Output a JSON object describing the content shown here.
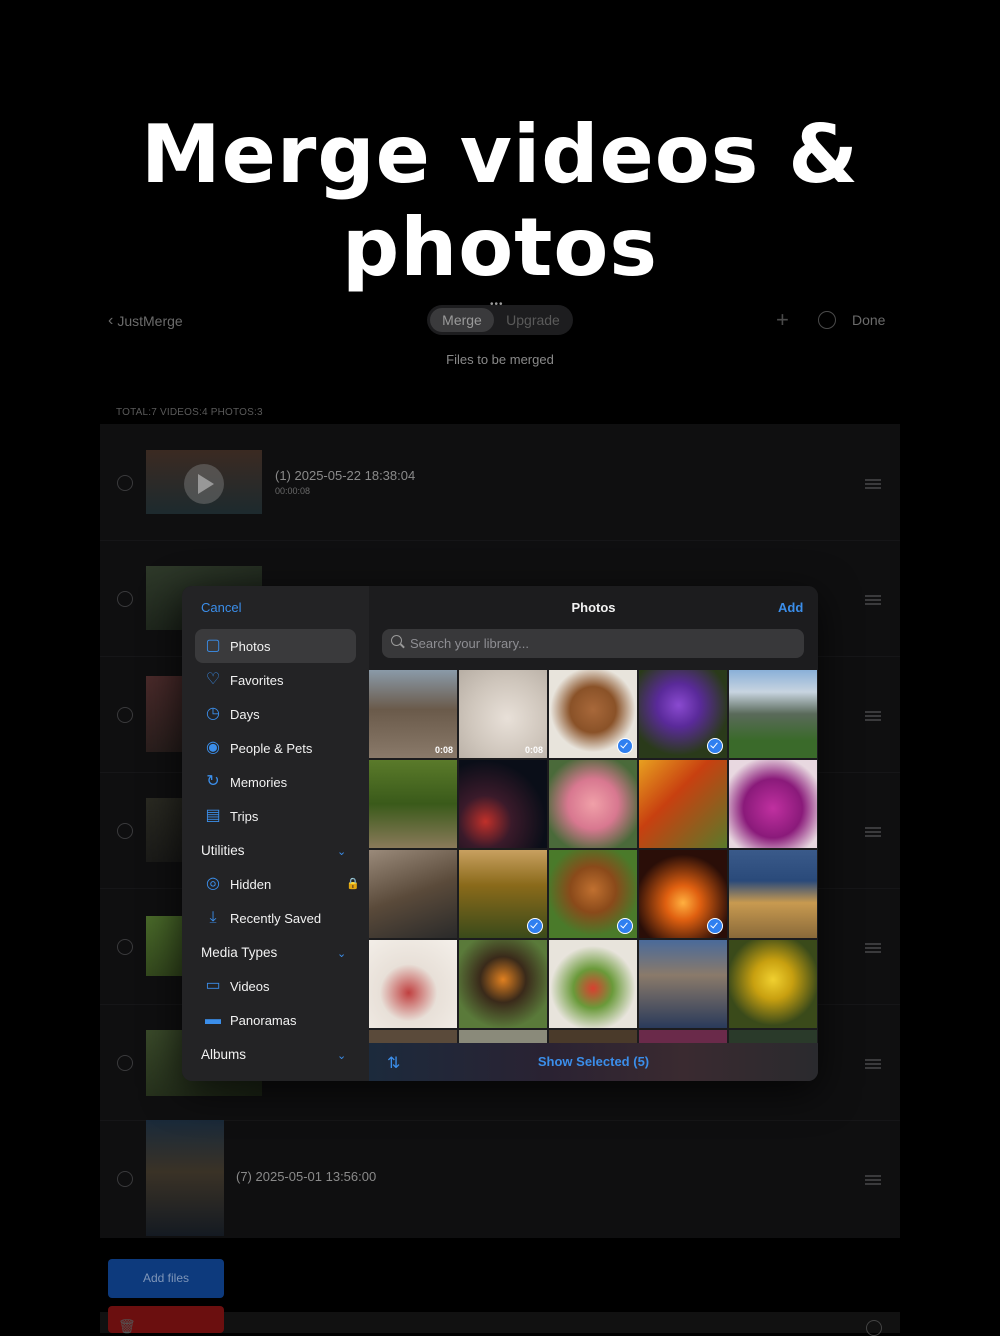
{
  "headline": "Merge videos & photos",
  "app": {
    "back_label": "JustMerge",
    "segments": [
      "Merge",
      "Upgrade"
    ],
    "done_label": "Done",
    "subtitle": "Files to be merged",
    "totals": "TOTAL:7 VIDEOS:4 PHOTOS:3",
    "rows": [
      {
        "title": "(1) 2025-05-22 18:38:04",
        "duration": "00:00:08"
      },
      {
        "title": "(7) 2025-05-01 13:56:00"
      }
    ],
    "add_files_label": "Add files"
  },
  "picker": {
    "cancel_label": "Cancel",
    "title": "Photos",
    "add_label": "Add",
    "search_placeholder": "Search your library...",
    "sidebar": {
      "items": [
        {
          "label": "Photos",
          "icon": "photos-icon",
          "selected": true
        },
        {
          "label": "Favorites",
          "icon": "heart-icon"
        },
        {
          "label": "Days",
          "icon": "clock-icon"
        },
        {
          "label": "People & Pets",
          "icon": "person-icon"
        },
        {
          "label": "Memories",
          "icon": "memories-icon"
        },
        {
          "label": "Trips",
          "icon": "suitcase-icon"
        }
      ],
      "utilities_label": "Utilities",
      "utilities": [
        {
          "label": "Hidden",
          "icon": "eye-slash-icon",
          "locked": true
        },
        {
          "label": "Recently Saved",
          "icon": "download-icon"
        }
      ],
      "media_types_label": "Media Types",
      "media_types": [
        {
          "label": "Videos",
          "icon": "video-icon"
        },
        {
          "label": "Panoramas",
          "icon": "panorama-icon"
        }
      ],
      "albums_label": "Albums"
    },
    "grid": [
      {
        "subject": "street",
        "duration": "0:08",
        "selected": false
      },
      {
        "subject": "blossom",
        "duration": "0:08",
        "selected": false
      },
      {
        "subject": "puppy",
        "selected": true
      },
      {
        "subject": "crocus",
        "selected": true
      },
      {
        "subject": "mountains",
        "selected": false
      },
      {
        "subject": "park-path",
        "selected": false
      },
      {
        "subject": "light-trails",
        "selected": false
      },
      {
        "subject": "roses",
        "selected": false
      },
      {
        "subject": "autumn-leaves",
        "selected": false
      },
      {
        "subject": "tulip",
        "selected": false
      },
      {
        "subject": "scooter",
        "selected": false
      },
      {
        "subject": "sunflowers",
        "selected": true
      },
      {
        "subject": "spaniel",
        "selected": true
      },
      {
        "subject": "campfire",
        "selected": true
      },
      {
        "subject": "jaguar",
        "selected": false
      },
      {
        "subject": "dessert",
        "selected": false
      },
      {
        "subject": "butterfly",
        "selected": false
      },
      {
        "subject": "salad",
        "selected": false
      },
      {
        "subject": "city-reflection",
        "selected": false
      },
      {
        "subject": "yellow-flowers",
        "selected": false
      }
    ],
    "show_selected_label": "Show Selected (5)"
  }
}
